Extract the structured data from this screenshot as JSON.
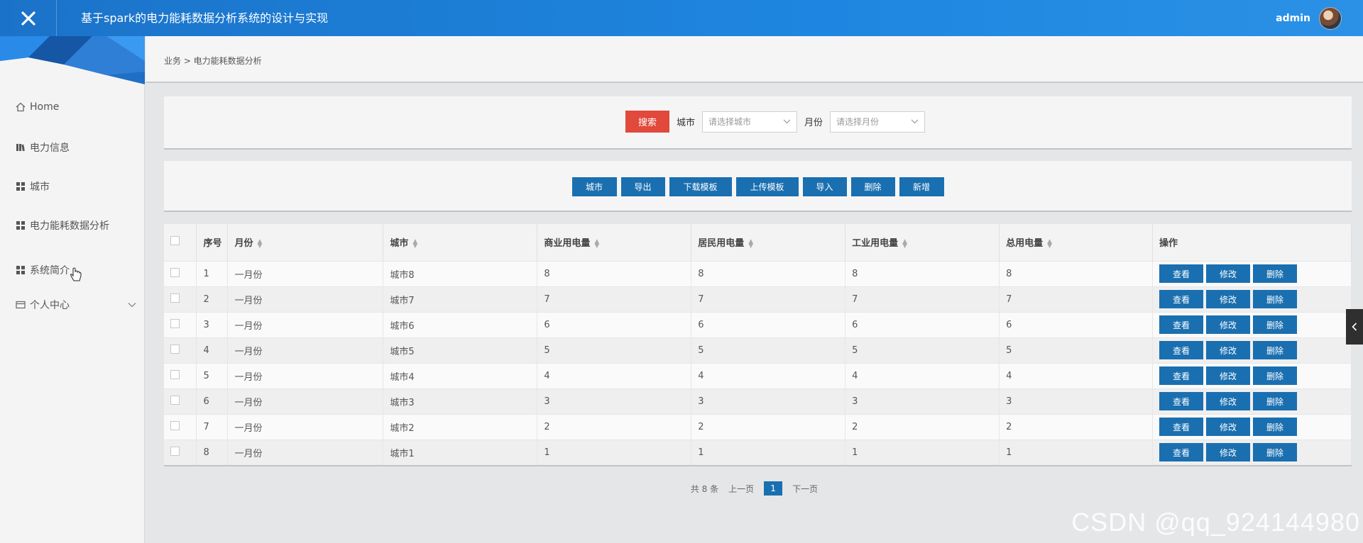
{
  "app": {
    "title": "基于spark的电力能耗数据分析系统的设计与实现",
    "user": "admin"
  },
  "sidebar": {
    "items": [
      {
        "label": "Home"
      },
      {
        "label": "电力信息"
      },
      {
        "label": "城市"
      },
      {
        "label": "电力能耗数据分析"
      },
      {
        "label": "系统简介"
      },
      {
        "label": "个人中心"
      }
    ]
  },
  "breadcrumb": "业务 > 电力能耗数据分析",
  "search": {
    "button": "搜索",
    "city_label": "城市",
    "city_placeholder": "请选择城市",
    "month_label": "月份",
    "month_placeholder": "请选择月份"
  },
  "actions": [
    "城市",
    "导出",
    "下载模板",
    "上传模板",
    "导入",
    "删除",
    "新增"
  ],
  "table": {
    "headers": [
      "序号",
      "月份",
      "城市",
      "商业用电量",
      "居民用电量",
      "工业用电量",
      "总用电量",
      "操作"
    ],
    "row_buttons": {
      "view": "查看",
      "edit": "修改",
      "delete": "删除"
    },
    "rows": [
      {
        "no": "1",
        "month": "一月份",
        "city": "城市8",
        "commercial": "8",
        "residential": "8",
        "industrial": "8",
        "total": "8"
      },
      {
        "no": "2",
        "month": "一月份",
        "city": "城市7",
        "commercial": "7",
        "residential": "7",
        "industrial": "7",
        "total": "7"
      },
      {
        "no": "3",
        "month": "一月份",
        "city": "城市6",
        "commercial": "6",
        "residential": "6",
        "industrial": "6",
        "total": "6"
      },
      {
        "no": "4",
        "month": "一月份",
        "city": "城市5",
        "commercial": "5",
        "residential": "5",
        "industrial": "5",
        "total": "5"
      },
      {
        "no": "5",
        "month": "一月份",
        "city": "城市4",
        "commercial": "4",
        "residential": "4",
        "industrial": "4",
        "total": "4"
      },
      {
        "no": "6",
        "month": "一月份",
        "city": "城市3",
        "commercial": "3",
        "residential": "3",
        "industrial": "3",
        "total": "3"
      },
      {
        "no": "7",
        "month": "一月份",
        "city": "城市2",
        "commercial": "2",
        "residential": "2",
        "industrial": "2",
        "total": "2"
      },
      {
        "no": "8",
        "month": "一月份",
        "city": "城市1",
        "commercial": "1",
        "residential": "1",
        "industrial": "1",
        "total": "1"
      }
    ]
  },
  "pagination": {
    "total": "共 8 条",
    "prev": "上一页",
    "current": "1",
    "next": "下一页"
  },
  "watermark": "CSDN @qq_924144980",
  "colors": {
    "header": "#1e86e0",
    "primary_button": "#1a6fb0",
    "search_button": "#e0493b"
  }
}
